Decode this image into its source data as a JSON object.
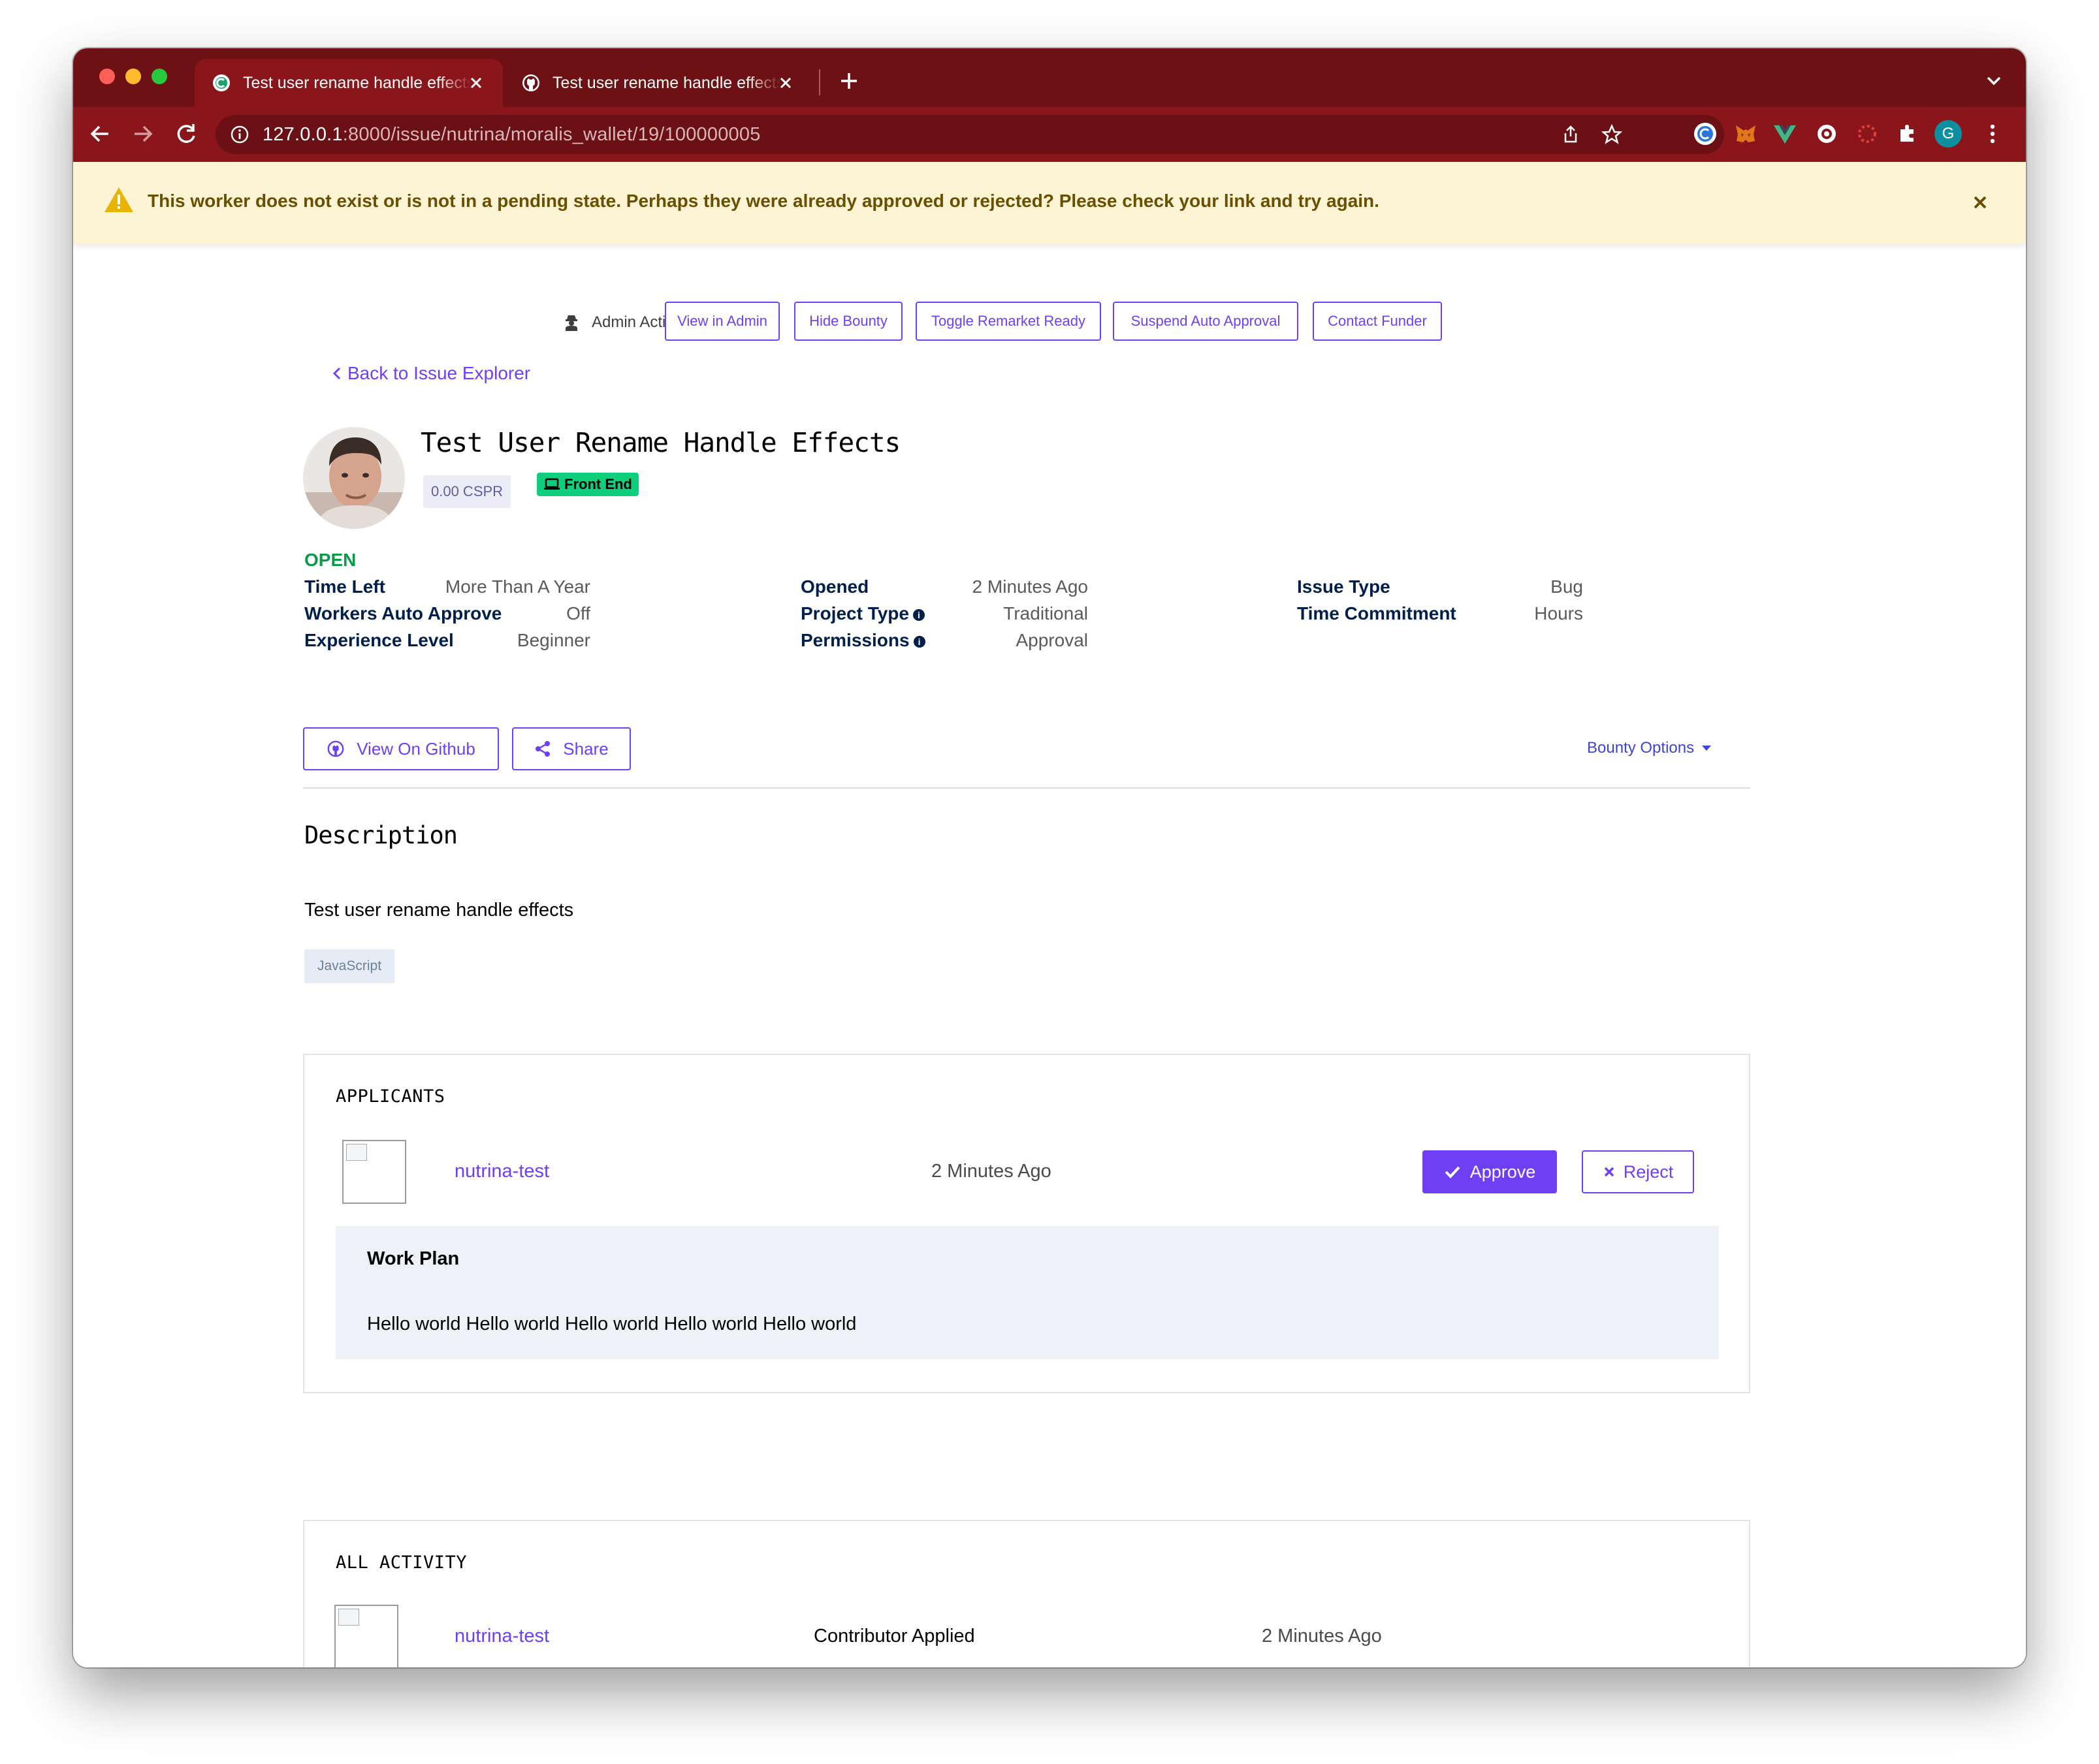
{
  "browser": {
    "tabs": [
      {
        "title": "Test user rename handle effects",
        "active": true,
        "favicon": "gitcoin-icon"
      },
      {
        "title": "Test user rename handle effects",
        "active": false,
        "favicon": "github-icon"
      }
    ],
    "url_host": "127.0.0.1",
    "url_path": ":8000/issue/nutrina/moralis_wallet/19/100000005",
    "profile_initial": "G",
    "theme_color": "#8a161b"
  },
  "alert": {
    "message": "This worker does not exist or is not in a pending state. Perhaps they were already approved or rejected? Please check your link and try again."
  },
  "admin": {
    "label": "Admin Actions",
    "buttons": [
      "View in Admin",
      "Hide Bounty",
      "Toggle Remarket Ready",
      "Suspend Auto Approval",
      "Contact Funder"
    ]
  },
  "nav": {
    "back_label": "Back to Issue Explorer"
  },
  "issue": {
    "title": "Test User Rename Handle Effects",
    "amount": "0.00 CSPR",
    "keyword": "Front End",
    "status": "OPEN",
    "details": {
      "col1": [
        {
          "label": "Time Left",
          "value": "More Than A Year"
        },
        {
          "label": "Workers Auto Approve",
          "value": "Off"
        },
        {
          "label": "Experience Level",
          "value": "Beginner"
        }
      ],
      "col2": [
        {
          "label": "Opened",
          "value": "2 Minutes Ago"
        },
        {
          "label": "Project Type",
          "value": "Traditional"
        },
        {
          "label": "Permissions",
          "value": "Approval"
        }
      ],
      "col3": [
        {
          "label": "Issue Type",
          "value": "Bug"
        },
        {
          "label": "Time Commitment",
          "value": "Hours"
        }
      ]
    },
    "actions": {
      "github_label": "View On Github",
      "share_label": "Share",
      "bounty_options_label": "Bounty Options"
    },
    "description": {
      "heading": "Description",
      "text": "Test user rename handle effects",
      "tags": [
        "JavaScript"
      ]
    }
  },
  "applicants": {
    "heading": "APPLICANTS",
    "items": [
      {
        "handle": "nutrina-test",
        "time": "2 Minutes Ago",
        "approve_label": "Approve",
        "reject_label": "Reject",
        "work_plan_title": "Work Plan",
        "work_plan": "Hello world Hello world Hello world Hello world Hello world"
      }
    ]
  },
  "activity": {
    "heading": "ALL ACTIVITY",
    "items": [
      {
        "handle": "nutrina-test",
        "event": "Contributor Applied",
        "time": "2 Minutes Ago"
      }
    ]
  },
  "colors": {
    "accent": "#6f3ff5",
    "open_status": "#0b9a4a",
    "label_navy": "#011f4b",
    "alert_bg": "#fcf4d5",
    "keyword_green": "#0fce7c"
  }
}
